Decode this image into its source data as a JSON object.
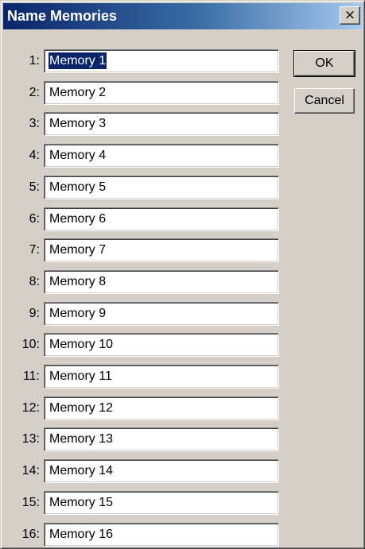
{
  "window": {
    "title": "Name Memories",
    "close_glyph": "×"
  },
  "buttons": {
    "ok_label": "OK",
    "cancel_label": "Cancel"
  },
  "memories": [
    {
      "label": "1:",
      "value": "Memory 1"
    },
    {
      "label": "2:",
      "value": "Memory 2"
    },
    {
      "label": "3:",
      "value": "Memory 3"
    },
    {
      "label": "4:",
      "value": "Memory 4"
    },
    {
      "label": "5:",
      "value": "Memory 5"
    },
    {
      "label": "6:",
      "value": "Memory 6"
    },
    {
      "label": "7:",
      "value": "Memory 7"
    },
    {
      "label": "8:",
      "value": "Memory 8"
    },
    {
      "label": "9:",
      "value": "Memory 9"
    },
    {
      "label": "10:",
      "value": "Memory 10"
    },
    {
      "label": "11:",
      "value": "Memory 11"
    },
    {
      "label": "12:",
      "value": "Memory 12"
    },
    {
      "label": "13:",
      "value": "Memory 13"
    },
    {
      "label": "14:",
      "value": "Memory 14"
    },
    {
      "label": "15:",
      "value": "Memory 15"
    },
    {
      "label": "16:",
      "value": "Memory 16"
    }
  ],
  "selected_index": 0
}
